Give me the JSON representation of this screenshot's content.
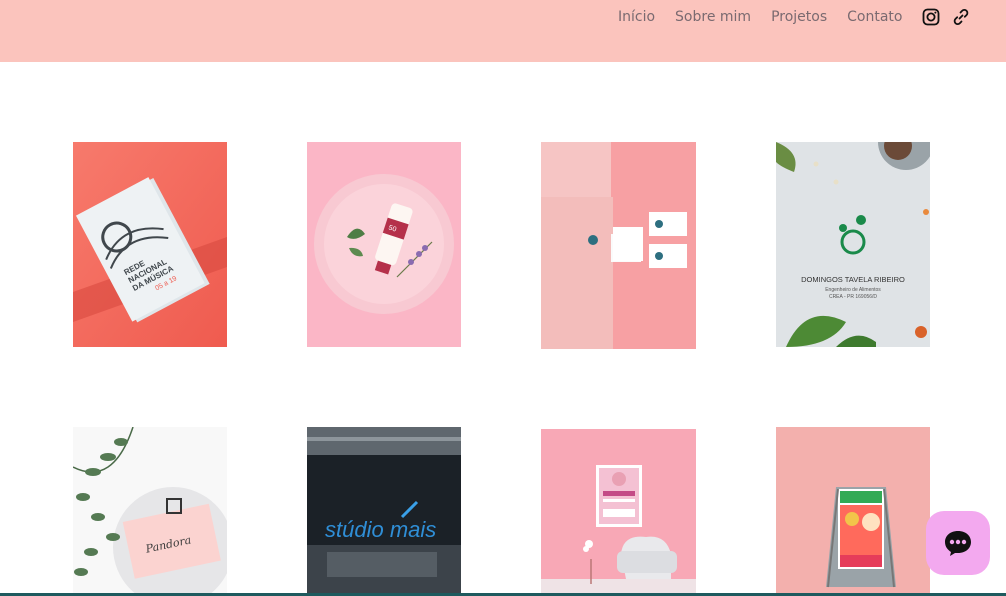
{
  "nav": {
    "items": [
      {
        "label": "Início"
      },
      {
        "label": "Sobre mim"
      },
      {
        "label": "Projetos"
      },
      {
        "label": "Contato"
      }
    ]
  },
  "social": {
    "icons": [
      "instagram-icon",
      "link-icon"
    ]
  },
  "portfolio": {
    "item2_label": "50",
    "item4_name": "DOMINGOS TAVELA RIBEIRO",
    "item4_role": "Engenheiro de Alimentos",
    "item4_crea": "CREA - PR 169056/D",
    "item6_sign": "stúdio mais",
    "item5_brand": "Pandora",
    "item1_lines": [
      "REDE",
      "NACIONAL",
      "DA MÚSICA",
      "05 a 19"
    ]
  },
  "colors": {
    "header": "#fbc4bd",
    "chat": "#f3a9ef",
    "nav_text": "#7a6a70"
  }
}
